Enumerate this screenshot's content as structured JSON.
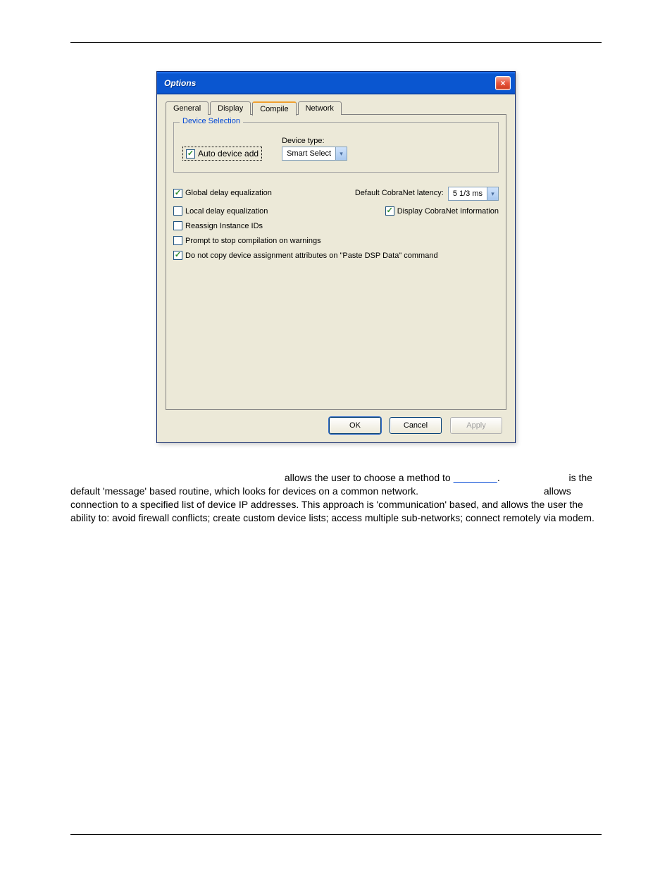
{
  "dialog": {
    "title": "Options",
    "tabs": [
      "General",
      "Display",
      "Compile",
      "Network"
    ],
    "active_tab": "Compile",
    "fieldset_label": "Device Selection",
    "auto_device_add": {
      "label": "Auto device add",
      "checked": true
    },
    "device_type_label": "Device type:",
    "device_type_value": "Smart Select",
    "global_delay": {
      "label": "Global delay equalization",
      "checked": true
    },
    "default_cobranet_label": "Default CobraNet latency:",
    "default_cobranet_value": "5 1/3 ms",
    "local_delay": {
      "label": "Local delay equalization",
      "checked": false
    },
    "display_cobranet": {
      "label": "Display CobraNet Information",
      "checked": true
    },
    "reassign_ids": {
      "label": "Reassign Instance IDs",
      "checked": false
    },
    "prompt_stop": {
      "label": "Prompt to stop compilation on warnings",
      "checked": false
    },
    "do_not_copy": {
      "label": "Do not copy device assignment attributes on \"Paste DSP Data\" command",
      "checked": true
    },
    "buttons": {
      "ok": "OK",
      "cancel": "Cancel",
      "apply": "Apply"
    }
  },
  "para": {
    "t1": " allows the user to choose a method to ",
    "t2": " is the default 'message' based routine, which looks for devices on a common network. ",
    "t3": " allows connection to a specified list of device IP addresses. This approach is 'communication' based, and allows the user the ability to: avoid firewall conflicts; create custom device lists; access multiple sub-networks; connect remotely via modem."
  }
}
